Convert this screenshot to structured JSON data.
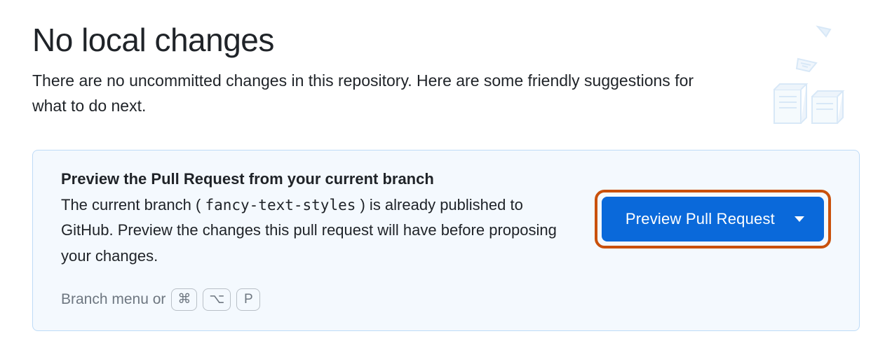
{
  "header": {
    "title": "No local changes",
    "subtitle": "There are no uncommitted changes in this repository. Here are some friendly suggestions for what to do next."
  },
  "panel": {
    "title": "Preview the Pull Request from your current branch",
    "desc_prefix": "The current branch ( ",
    "branch_name": "fancy-text-styles",
    "desc_suffix": " ) is already published to GitHub. Preview the changes this pull request will have before proposing your changes.",
    "cta_label": "Preview Pull Request",
    "hint_prefix": "Branch menu or",
    "keys": {
      "cmd": "⌘",
      "opt": "⌥",
      "p": "P"
    }
  }
}
